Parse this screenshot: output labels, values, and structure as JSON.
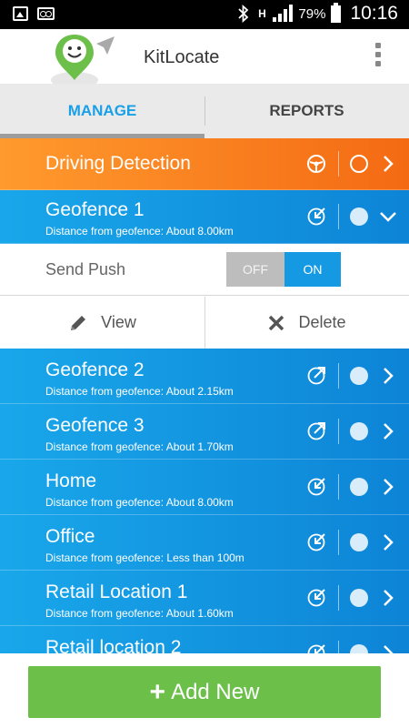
{
  "status_bar": {
    "battery": "79%",
    "time": "10:16",
    "network": "H"
  },
  "app": {
    "title": "KitLocate"
  },
  "tabs": [
    {
      "label": "MANAGE",
      "active": true
    },
    {
      "label": "REPORTS",
      "active": false
    }
  ],
  "driving": {
    "title": "Driving Detection",
    "icon": "steering-wheel-icon"
  },
  "geofences": [
    {
      "title": "Geofence 1",
      "subtitle": "Distance from geofence: About 8.00km",
      "direction": "enter",
      "expanded": true
    },
    {
      "title": "Geofence 2",
      "subtitle": "Distance from geofence: About 2.15km",
      "direction": "exit",
      "expanded": false
    },
    {
      "title": "Geofence 3",
      "subtitle": "Distance from geofence: About 1.70km",
      "direction": "exit",
      "expanded": false
    },
    {
      "title": "Home",
      "subtitle": "Distance from geofence: About 8.00km",
      "direction": "enter",
      "expanded": false
    },
    {
      "title": "Office",
      "subtitle": "Distance from geofence: Less than 100m",
      "direction": "enter",
      "expanded": false
    },
    {
      "title": "Retail Location 1",
      "subtitle": "Distance from geofence: About 1.60km",
      "direction": "enter",
      "expanded": false
    },
    {
      "title": "Retail location 2",
      "subtitle": "",
      "direction": "enter",
      "expanded": false
    }
  ],
  "expanded_panel": {
    "push_label": "Send Push",
    "off_label": "OFF",
    "on_label": "ON",
    "push_state": "ON",
    "view_label": "View",
    "delete_label": "Delete"
  },
  "add_button": {
    "label": "Add New"
  },
  "colors": {
    "blue": "#1599e3",
    "orange": "#f57c1e",
    "green": "#6cc04a"
  }
}
